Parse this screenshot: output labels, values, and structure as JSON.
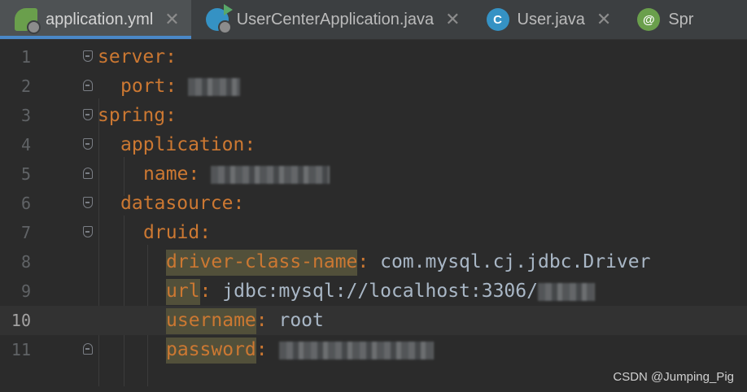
{
  "tabs": [
    {
      "label": "application.yml",
      "icon": "spring-leaf-icon",
      "active": true
    },
    {
      "label": "UserCenterApplication.java",
      "icon": "run-class-icon",
      "active": false
    },
    {
      "label": "User.java",
      "icon": "class-c-icon",
      "glyph": "C",
      "active": false
    },
    {
      "label": "Spr",
      "icon": "spring-annotation-icon",
      "glyph": "@",
      "active": false
    }
  ],
  "close_glyph": "✕",
  "lines": [
    {
      "num": "1",
      "key": "server",
      "colon": ":",
      "value": ""
    },
    {
      "num": "2",
      "key": "port",
      "colon": ":",
      "value": ""
    },
    {
      "num": "3",
      "key": "spring",
      "colon": ":",
      "value": ""
    },
    {
      "num": "4",
      "key": "application",
      "colon": ":",
      "value": ""
    },
    {
      "num": "5",
      "key": "name",
      "colon": ":",
      "value": ""
    },
    {
      "num": "6",
      "key": "datasource",
      "colon": ":",
      "value": ""
    },
    {
      "num": "7",
      "key": "druid",
      "colon": ":",
      "value": ""
    },
    {
      "num": "8",
      "key": "driver-class-name",
      "colon": ":",
      "value": " com.mysql.cj.jdbc.Driver"
    },
    {
      "num": "9",
      "key": "url",
      "colon": ":",
      "value": " jdbc:mysql://localhost:3306/"
    },
    {
      "num": "10",
      "key": "username",
      "colon": ":",
      "value": " root"
    },
    {
      "num": "11",
      "key": "password",
      "colon": ":",
      "value": ""
    }
  ],
  "current_line": "10",
  "watermark": "CSDN @Jumping_Pig"
}
